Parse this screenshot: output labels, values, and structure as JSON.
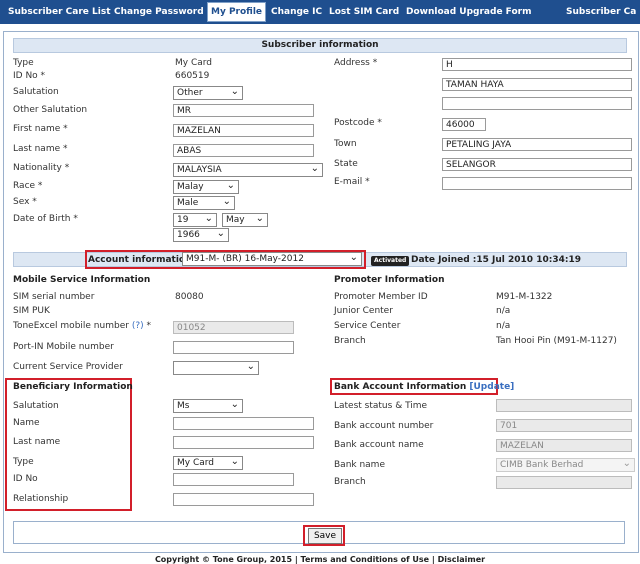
{
  "nav": {
    "items": [
      "Subscriber Care List",
      "Change Password",
      "My Profile",
      "Change IC",
      "Lost SIM Card",
      "Download Upgrade Form",
      "Subscriber Ca"
    ]
  },
  "subscriber": {
    "header": "Subscriber information",
    "type_label": "Type",
    "type_value": "My Card",
    "id_label": "ID No *",
    "id_value": "660519",
    "salutation_label": "Salutation",
    "salutation_value": "Other",
    "other_salutation_label": "Other Salutation",
    "other_salutation_value": "MR",
    "first_name_label": "First name *",
    "first_name_value": "MAZELAN",
    "last_name_label": "Last name *",
    "last_name_value": "ABAS",
    "nationality_label": "Nationality *",
    "nationality_value": "MALAYSIA",
    "race_label": "Race *",
    "race_value": "Malay",
    "sex_label": "Sex *",
    "sex_value": "Male",
    "dob_label": "Date of Birth *",
    "dob_day": "19",
    "dob_month": "May",
    "dob_year": "1966",
    "address_label": "Address *",
    "address_line1": "H",
    "address_line2": "TAMAN  HAYA",
    "address_line3": "",
    "postcode_label": "Postcode *",
    "postcode_value": "46000",
    "town_label": "Town",
    "town_value": "PETALING JAYA",
    "state_label": "State",
    "state_value": "SELANGOR",
    "email_label": "E-mail *",
    "email_value": ""
  },
  "account": {
    "label": "Account information",
    "selected": "M91-M-           (BR) 16-May-2012",
    "status_badge": "Activated",
    "date_joined": "Date Joined :15 Jul 2010 10:34:19"
  },
  "mobile": {
    "header": "Mobile Service Information",
    "sim_serial_label": "SIM serial number",
    "sim_serial_value": "80080",
    "sim_puk_label": "SIM PUK",
    "toneexcel_label": "ToneExcel mobile number",
    "toneexcel_help": "(?)",
    "toneexcel_req": " *",
    "toneexcel_value": "01052",
    "portin_label": "Port-IN Mobile number",
    "portin_value": "",
    "current_provider_label": "Current Service Provider",
    "current_provider_value": ""
  },
  "promoter": {
    "header": "Promoter Information",
    "member_id_label": "Promoter Member ID",
    "member_id_value": "M91-M-1322",
    "junior_label": "Junior Center",
    "junior_value": "n/a",
    "service_label": "Service Center",
    "service_value": "n/a",
    "branch_label": "Branch",
    "branch_value": "Tan Hooi Pin (M91-M-1127)"
  },
  "beneficiary": {
    "header": "Beneficiary Information",
    "salutation_label": "Salutation",
    "salutation_value": "Ms",
    "name_label": "Name",
    "name_value": "",
    "last_name_label": "Last name",
    "last_name_value": "",
    "type_label": "Type",
    "type_value": "My Card",
    "id_label": "ID No",
    "id_value": "",
    "relationship_label": "Relationship",
    "relationship_value": ""
  },
  "bank": {
    "header": "Bank Account Information",
    "update_link": "[Update]",
    "latest_status_label": "Latest status & Time",
    "latest_status_value": "",
    "account_number_label": "Bank account number",
    "account_number_value": "701",
    "account_name_label": "Bank account name",
    "account_name_value": "MAZELAN",
    "bank_name_label": "Bank name",
    "bank_name_value": "CIMB Bank Berhad",
    "branch_label": "Branch",
    "branch_value": ""
  },
  "actions": {
    "save_label": "Save"
  },
  "footer": {
    "text": "Copyright © Tone Group, 2015 | Terms and Conditions of Use | Disclaimer"
  },
  "colors": {
    "nav_bg": "#1f4f8f",
    "highlight": "#d21f2a",
    "section_bar": "#dde7f3",
    "link": "#3a6fc0"
  }
}
